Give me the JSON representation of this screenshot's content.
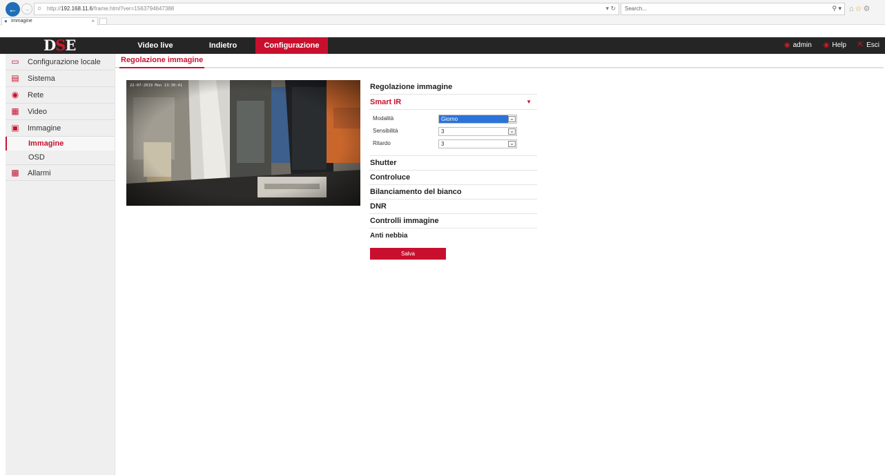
{
  "browser": {
    "url_prefix": "http://",
    "url_host": "192.168.11.6",
    "url_path": "/frame.html?ver=1563794647388",
    "search_placeholder": "Search...",
    "tab_title": "Immagine"
  },
  "header": {
    "logo": {
      "left": "D",
      "mid": "S",
      "right": "E"
    },
    "menu": [
      {
        "label": "Video live"
      },
      {
        "label": "Indietro"
      },
      {
        "label": "Configurazione"
      }
    ],
    "user": "admin",
    "help": "Help",
    "logout": "Esci"
  },
  "sidebar": {
    "items": [
      {
        "label": "Configurazione locale",
        "icon": "monitor-icon"
      },
      {
        "label": "Sistema",
        "icon": "system-icon"
      },
      {
        "label": "Rete",
        "icon": "network-icon"
      },
      {
        "label": "Video",
        "icon": "video-icon"
      },
      {
        "label": "Immagine",
        "icon": "image-icon"
      },
      {
        "label": "Allarmi",
        "icon": "alarm-icon"
      }
    ],
    "subitems": [
      {
        "label": "Immagine"
      },
      {
        "label": "OSD"
      }
    ]
  },
  "content": {
    "tab": "Regolazione immagine",
    "preview_timestamp": "22-07-2019 Mon 13:30:41"
  },
  "panel": {
    "title": "Regolazione immagine",
    "smart_ir": {
      "label": "Smart IR",
      "fields": [
        {
          "label": "Modalità",
          "value": "Giorno"
        },
        {
          "label": "Sensibilità",
          "value": "3"
        },
        {
          "label": "Ritardo",
          "value": "3"
        }
      ]
    },
    "sections": [
      "Shutter",
      "Controluce",
      "Bilanciamento del bianco",
      "DNR",
      "Controlli immagine",
      "Anti nebbia"
    ],
    "save_label": "Salva"
  },
  "colors": {
    "accent": "#c8102e",
    "header_bg": "#252525",
    "sidebar_bg": "#efefef"
  }
}
